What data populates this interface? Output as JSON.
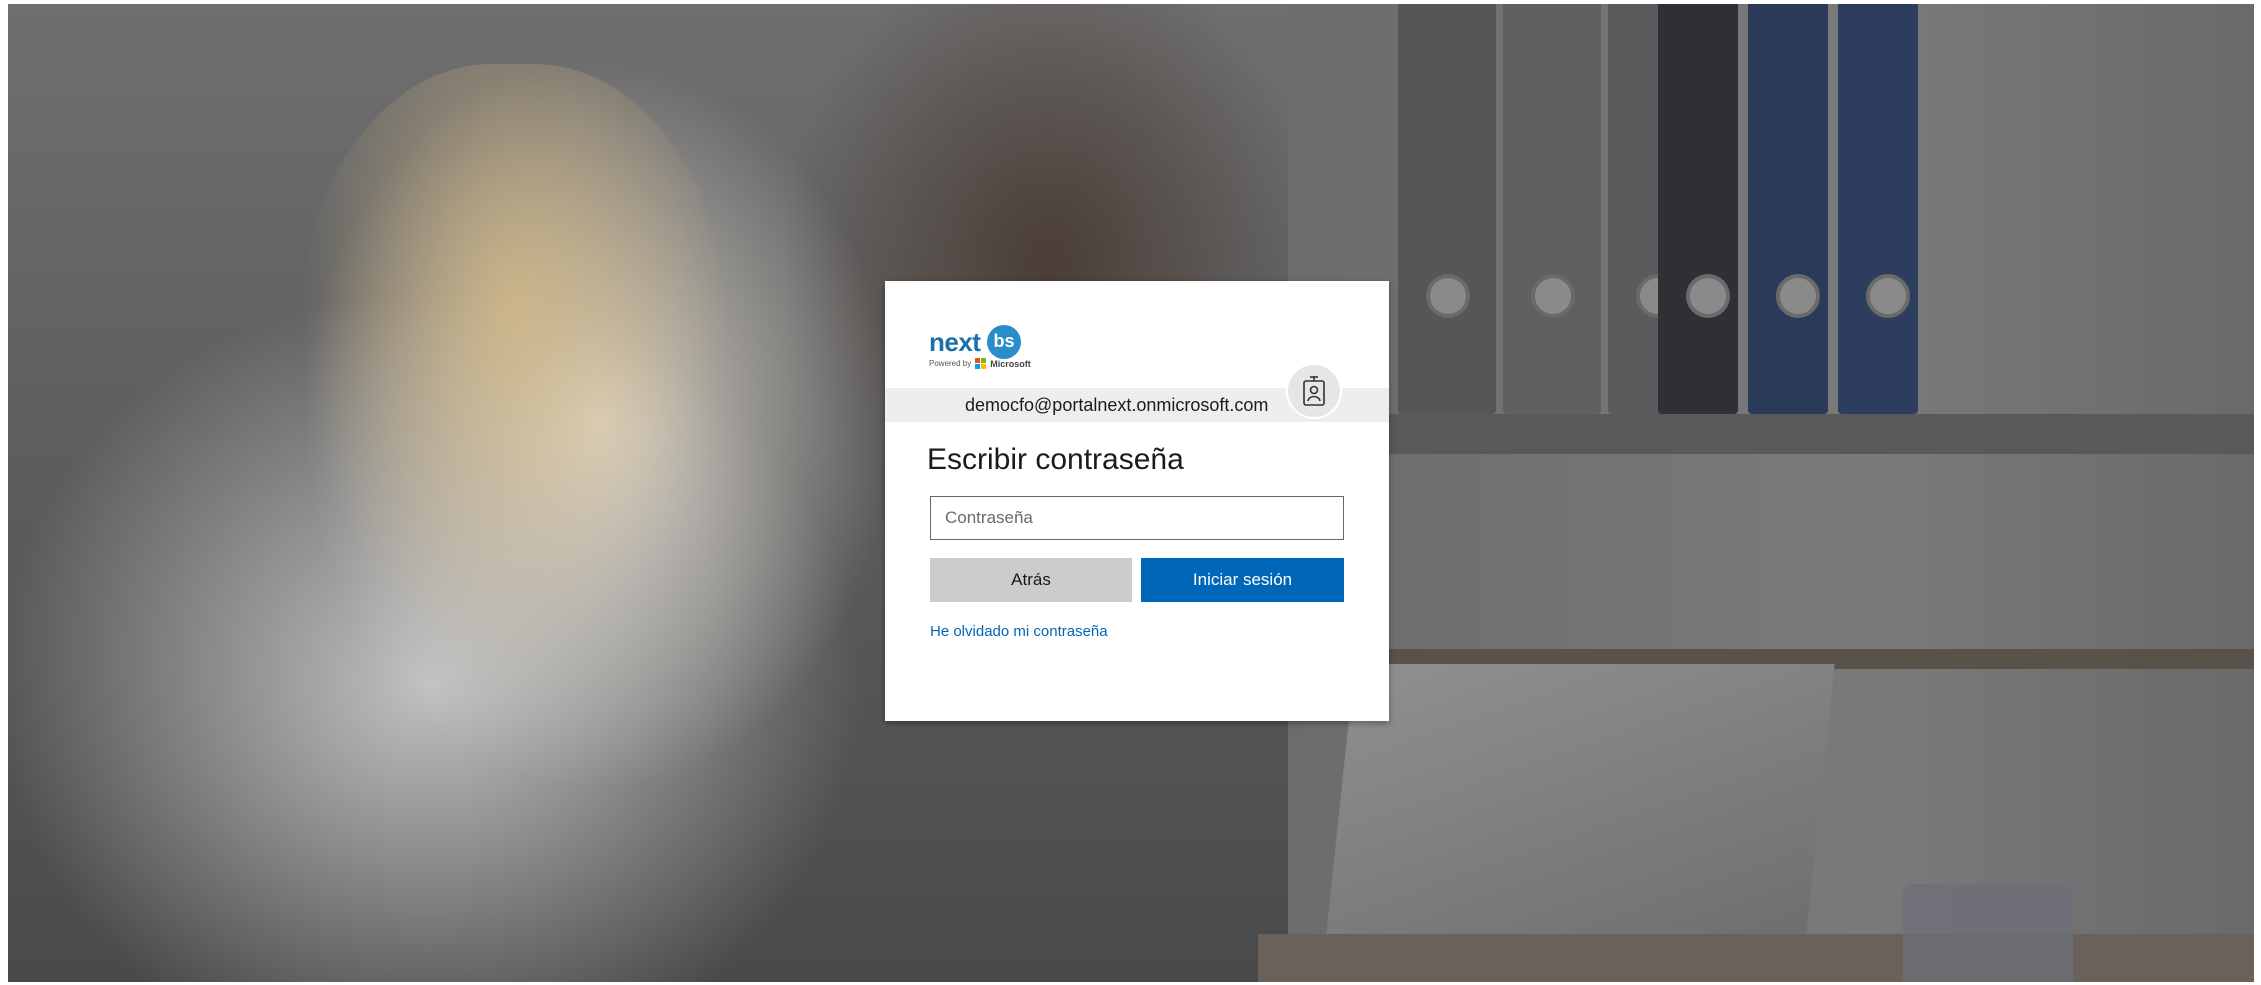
{
  "background": {
    "description_icon": "office-photo-background"
  },
  "logo": {
    "brand": "next",
    "badge": "bs",
    "powered_by": "Powered by",
    "microsoft": "Microsoft"
  },
  "identity": {
    "email": "democfo@portalnext.onmicrosoft.com",
    "icon": "id-badge-icon"
  },
  "form": {
    "title": "Escribir contraseña",
    "password_placeholder": "Contraseña",
    "password_value": "",
    "back_label": "Atrás",
    "signin_label": "Iniciar sesión",
    "forgot_label": "He olvidado mi contraseña"
  },
  "colors": {
    "primary": "#0067b8",
    "secondary_button": "#cccccc",
    "identity_bar": "#eeeeee"
  }
}
